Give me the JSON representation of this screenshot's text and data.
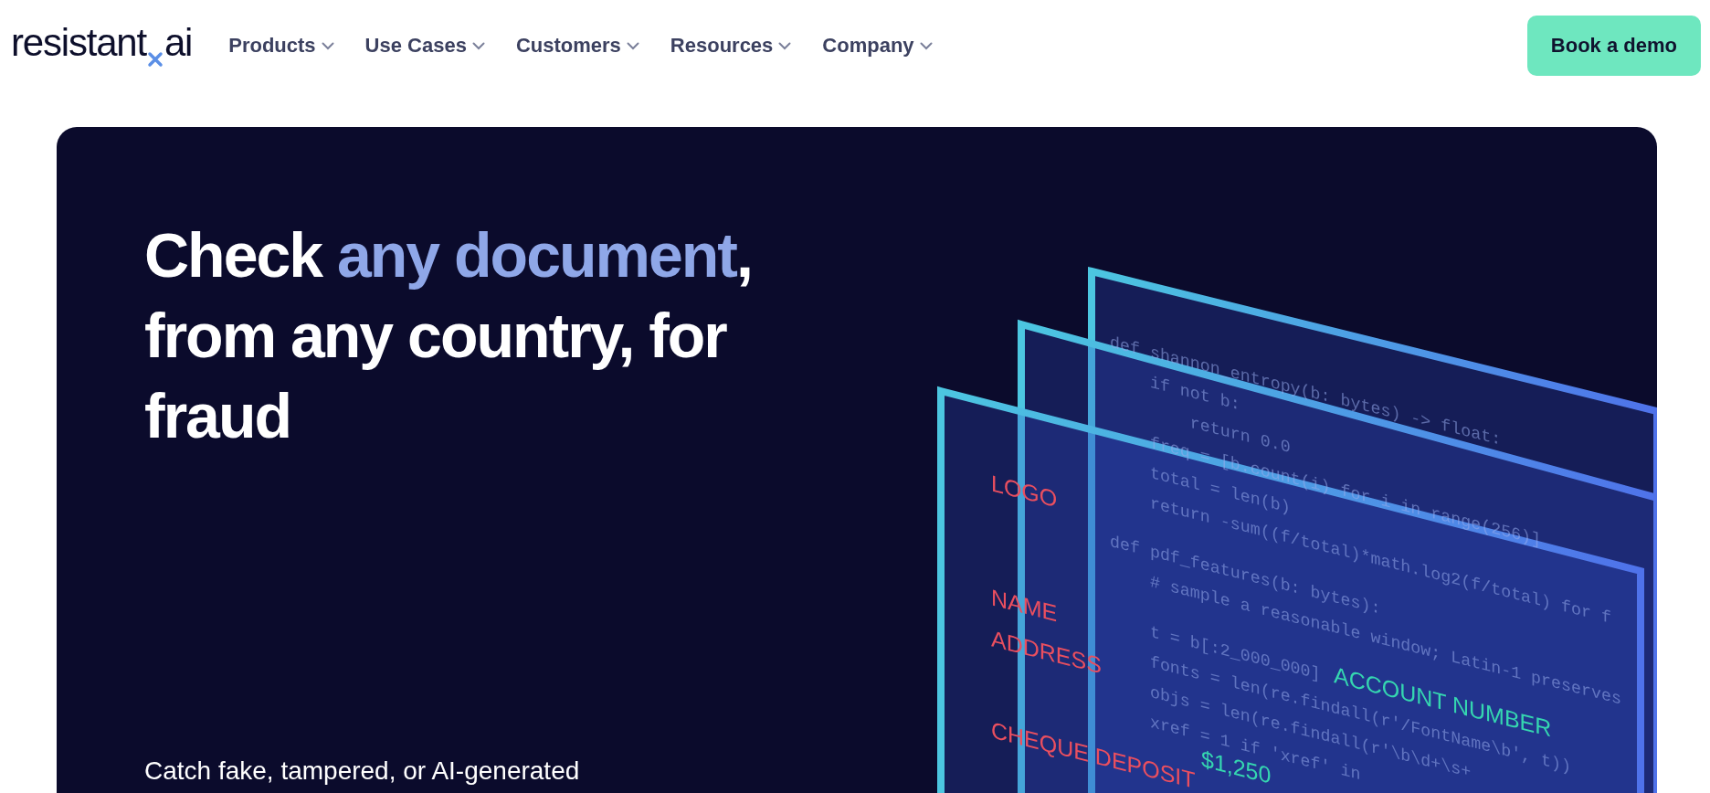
{
  "logo": {
    "before": "resistant",
    "after": "ai"
  },
  "nav": [
    {
      "label": "Products"
    },
    {
      "label": "Use Cases"
    },
    {
      "label": "Customers"
    },
    {
      "label": "Resources"
    },
    {
      "label": "Company"
    }
  ],
  "cta": "Book a demo",
  "hero": {
    "heading": [
      {
        "text": "Check ",
        "highlight": false
      },
      {
        "text": "any document",
        "highlight": true
      },
      {
        "text": ", from any country, for fraud",
        "highlight": false
      }
    ],
    "subtext": "Catch fake, tampered, or AI-generated",
    "illustration": {
      "code": [
        {
          "lines": [
            "def shannon_entropy(b: bytes) -> float:",
            "    if not b:",
            "        return 0.0",
            "    freq = [b.count(i) for i in range(256)]",
            "    total = len(b)",
            "    return -sum((f/total)*math.log2(f/total) for f"
          ]
        },
        {
          "lines": [
            "def pdf_features(b: bytes):",
            "    # sample a reasonable window; Latin-1 preserves"
          ]
        },
        {
          "lines": [
            "    t = b[:2_000_000]",
            "    fonts = len(re.findall(r'/FontName\\b', t))",
            "    objs = len(re.findall(r'\\b\\d+\\s+",
            "    xref = 1 if 'xref' in"
          ]
        }
      ],
      "labels": [
        {
          "text": "LOGO",
          "kind": "field"
        },
        {
          "text": "NAME",
          "kind": "field"
        },
        {
          "text": "ADDRESS",
          "kind": "field"
        },
        {
          "text": "CHEQUE DEPOSIT",
          "kind": "field"
        },
        {
          "text": "ACCOUNT NUMBER",
          "kind": "value"
        },
        {
          "text": "$1,250",
          "kind": "value"
        }
      ]
    }
  }
}
